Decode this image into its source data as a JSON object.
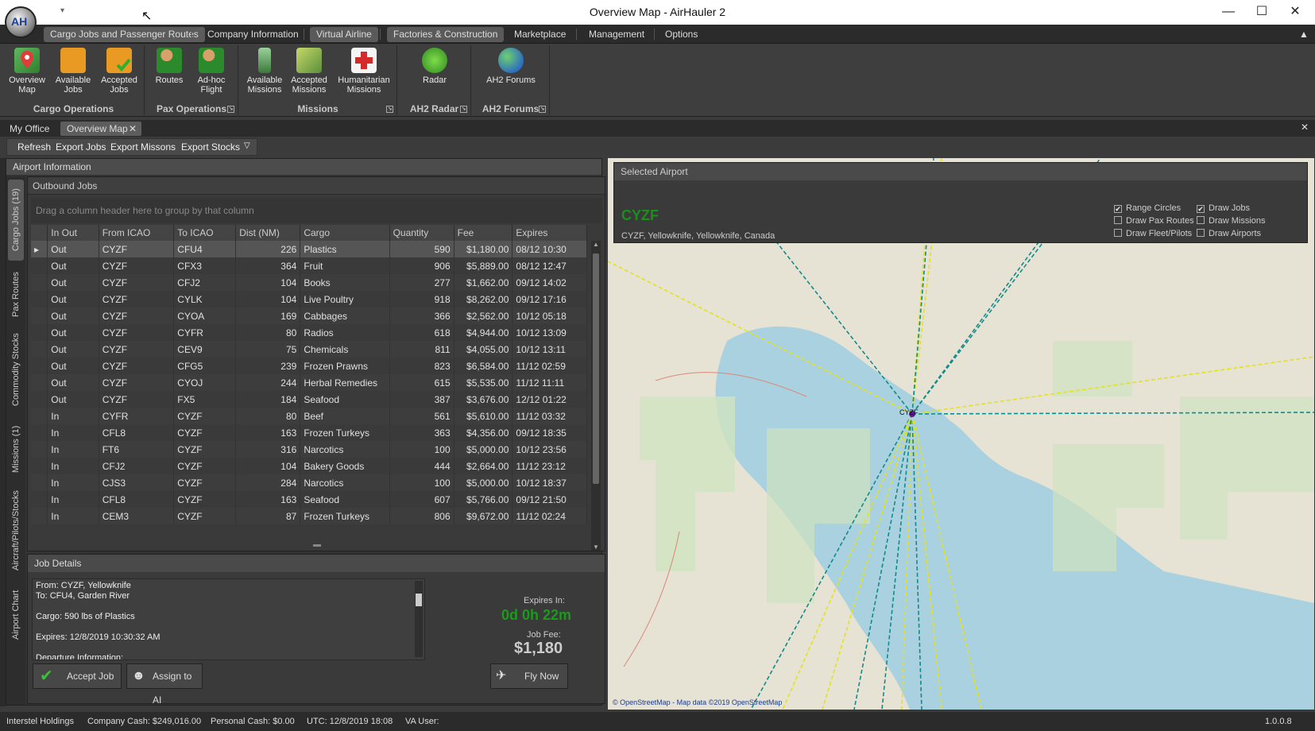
{
  "window": {
    "title": "Overview Map - AirHauler 2",
    "logo_text": "AH",
    "minimize": "—",
    "maximize": "☐",
    "close": "✕",
    "quick_access": "▾"
  },
  "menu": {
    "tabs": [
      "Cargo Jobs and Passenger Routes",
      "Company Information",
      "Virtual Airline",
      "Factories & Construction",
      "Marketplace",
      "Management",
      "Options"
    ],
    "collapse": "▲"
  },
  "ribbon": {
    "groups": [
      {
        "label": "Cargo Operations",
        "buttons": [
          {
            "label": "Overview Map",
            "icon": "map-pin-icon"
          },
          {
            "label": "Available Jobs",
            "icon": "box-icon"
          },
          {
            "label": "Accepted Jobs",
            "icon": "box-check-icon"
          }
        ]
      },
      {
        "label": "Pax Operations",
        "buttons": [
          {
            "label": "Routes",
            "icon": "passengers-icon"
          },
          {
            "label": "Ad-hoc Flight",
            "icon": "passengers-icon"
          }
        ]
      },
      {
        "label": "Missions",
        "buttons": [
          {
            "label": "Available Missions",
            "icon": "phone-icon"
          },
          {
            "label": "Accepted Missions",
            "icon": "map-arrows-icon"
          },
          {
            "label": "Humanitarian Missions",
            "icon": "red-cross-icon"
          }
        ]
      },
      {
        "label": "AH2 Radar",
        "buttons": [
          {
            "label": "Radar",
            "icon": "radar-icon"
          }
        ]
      },
      {
        "label": "AH2 Forums",
        "buttons": [
          {
            "label": "AH2 Forums",
            "icon": "globe-icon"
          }
        ]
      }
    ]
  },
  "doc_tabs": {
    "office": "My Office",
    "map": "Overview Map",
    "close": "✕"
  },
  "toolbar": {
    "refresh": "Refresh",
    "export_jobs": "Export Jobs",
    "export_missions": "Export Missons",
    "export_stocks": "Export Stocks"
  },
  "airport_info": {
    "title": "Airport Information",
    "vertical_tabs": [
      "Cargo Jobs (19)",
      "Pax Routes",
      "Commodity Stocks",
      "Missions (1)",
      "Aircraft/Pilots/Stocks",
      "Airport Chart"
    ],
    "outbound_title": "Outbound Jobs",
    "group_hint": "Drag a column header here to group by that column",
    "columns": [
      "In Out",
      "From ICAO",
      "To ICAO",
      "Dist (NM)",
      "Cargo",
      "Quantity",
      "Fee",
      "Expires"
    ],
    "rows": [
      [
        "Out",
        "CYZF",
        "CFU4",
        "226",
        "Plastics",
        "590",
        "$1,180.00",
        "08/12 10:30"
      ],
      [
        "Out",
        "CYZF",
        "CFX3",
        "364",
        "Fruit",
        "906",
        "$5,889.00",
        "08/12 12:47"
      ],
      [
        "Out",
        "CYZF",
        "CFJ2",
        "104",
        "Books",
        "277",
        "$1,662.00",
        "09/12 14:02"
      ],
      [
        "Out",
        "CYZF",
        "CYLK",
        "104",
        "Live Poultry",
        "918",
        "$8,262.00",
        "09/12 17:16"
      ],
      [
        "Out",
        "CYZF",
        "CYOA",
        "169",
        "Cabbages",
        "366",
        "$2,562.00",
        "10/12 05:18"
      ],
      [
        "Out",
        "CYZF",
        "CYFR",
        "80",
        "Radios",
        "618",
        "$4,944.00",
        "10/12 13:09"
      ],
      [
        "Out",
        "CYZF",
        "CEV9",
        "75",
        "Chemicals",
        "811",
        "$4,055.00",
        "10/12 13:11"
      ],
      [
        "Out",
        "CYZF",
        "CFG5",
        "239",
        "Frozen Prawns",
        "823",
        "$6,584.00",
        "11/12 02:59"
      ],
      [
        "Out",
        "CYZF",
        "CYOJ",
        "244",
        "Herbal Remedies",
        "615",
        "$5,535.00",
        "11/12 11:11"
      ],
      [
        "Out",
        "CYZF",
        "FX5",
        "184",
        "Seafood",
        "387",
        "$3,676.00",
        "12/12 01:22"
      ],
      [
        "In",
        "CYFR",
        "CYZF",
        "80",
        "Beef",
        "561",
        "$5,610.00",
        "11/12 03:32"
      ],
      [
        "In",
        "CFL8",
        "CYZF",
        "163",
        "Frozen Turkeys",
        "363",
        "$4,356.00",
        "09/12 18:35"
      ],
      [
        "In",
        "FT6",
        "CYZF",
        "316",
        "Narcotics",
        "100",
        "$5,000.00",
        "10/12 23:56"
      ],
      [
        "In",
        "CFJ2",
        "CYZF",
        "104",
        "Bakery Goods",
        "444",
        "$2,664.00",
        "11/12 23:12"
      ],
      [
        "In",
        "CJS3",
        "CYZF",
        "284",
        "Narcotics",
        "100",
        "$5,000.00",
        "10/12 18:37"
      ],
      [
        "In",
        "CFL8",
        "CYZF",
        "163",
        "Seafood",
        "607",
        "$5,766.00",
        "09/12 21:50"
      ],
      [
        "In",
        "CEM3",
        "CYZF",
        "87",
        "Frozen Turkeys",
        "806",
        "$9,672.00",
        "11/12 02:24"
      ]
    ],
    "selected_row": 0
  },
  "job_details": {
    "title": "Job Details",
    "lines": [
      "From: CYZF, Yellowknife",
      "To: CFU4, Garden River",
      "",
      "Cargo: 590 lbs of Plastics",
      "",
      "Expires: 12/8/2019 10:30:32 AM",
      "",
      "Departure Information:"
    ],
    "expires_label": "Expires In:",
    "expires_value": "0d 0h 22m",
    "fee_label": "Job Fee:",
    "fee_value": "$1,180",
    "accept": "Accept Job",
    "assign": "Assign to AI",
    "fly": "Fly Now"
  },
  "selected_airport": {
    "title": "Selected Airport",
    "icao": "CYZF",
    "name": "CYZF, Yellowknife, Yellowknife, Canada",
    "options": [
      {
        "label": "Range Circles",
        "checked": true
      },
      {
        "label": "Draw Pax Routes",
        "checked": false
      },
      {
        "label": "Draw Fleet/Pilots",
        "checked": false
      },
      {
        "label": "Draw Jobs",
        "checked": true
      },
      {
        "label": "Draw Missions",
        "checked": false
      },
      {
        "label": "Draw Airports",
        "checked": false
      }
    ],
    "map_label": "CYZF",
    "attribution": "© OpenStreetMap - Map data ©2019 OpenStreetMap"
  },
  "status": {
    "company": "Interstel Holdings",
    "company_cash": "Company Cash: $249,016.00",
    "personal_cash": "Personal Cash: $0.00",
    "utc": "UTC: 12/8/2019 18:08",
    "va_user": "VA User:",
    "version": "1.0.0.8"
  }
}
